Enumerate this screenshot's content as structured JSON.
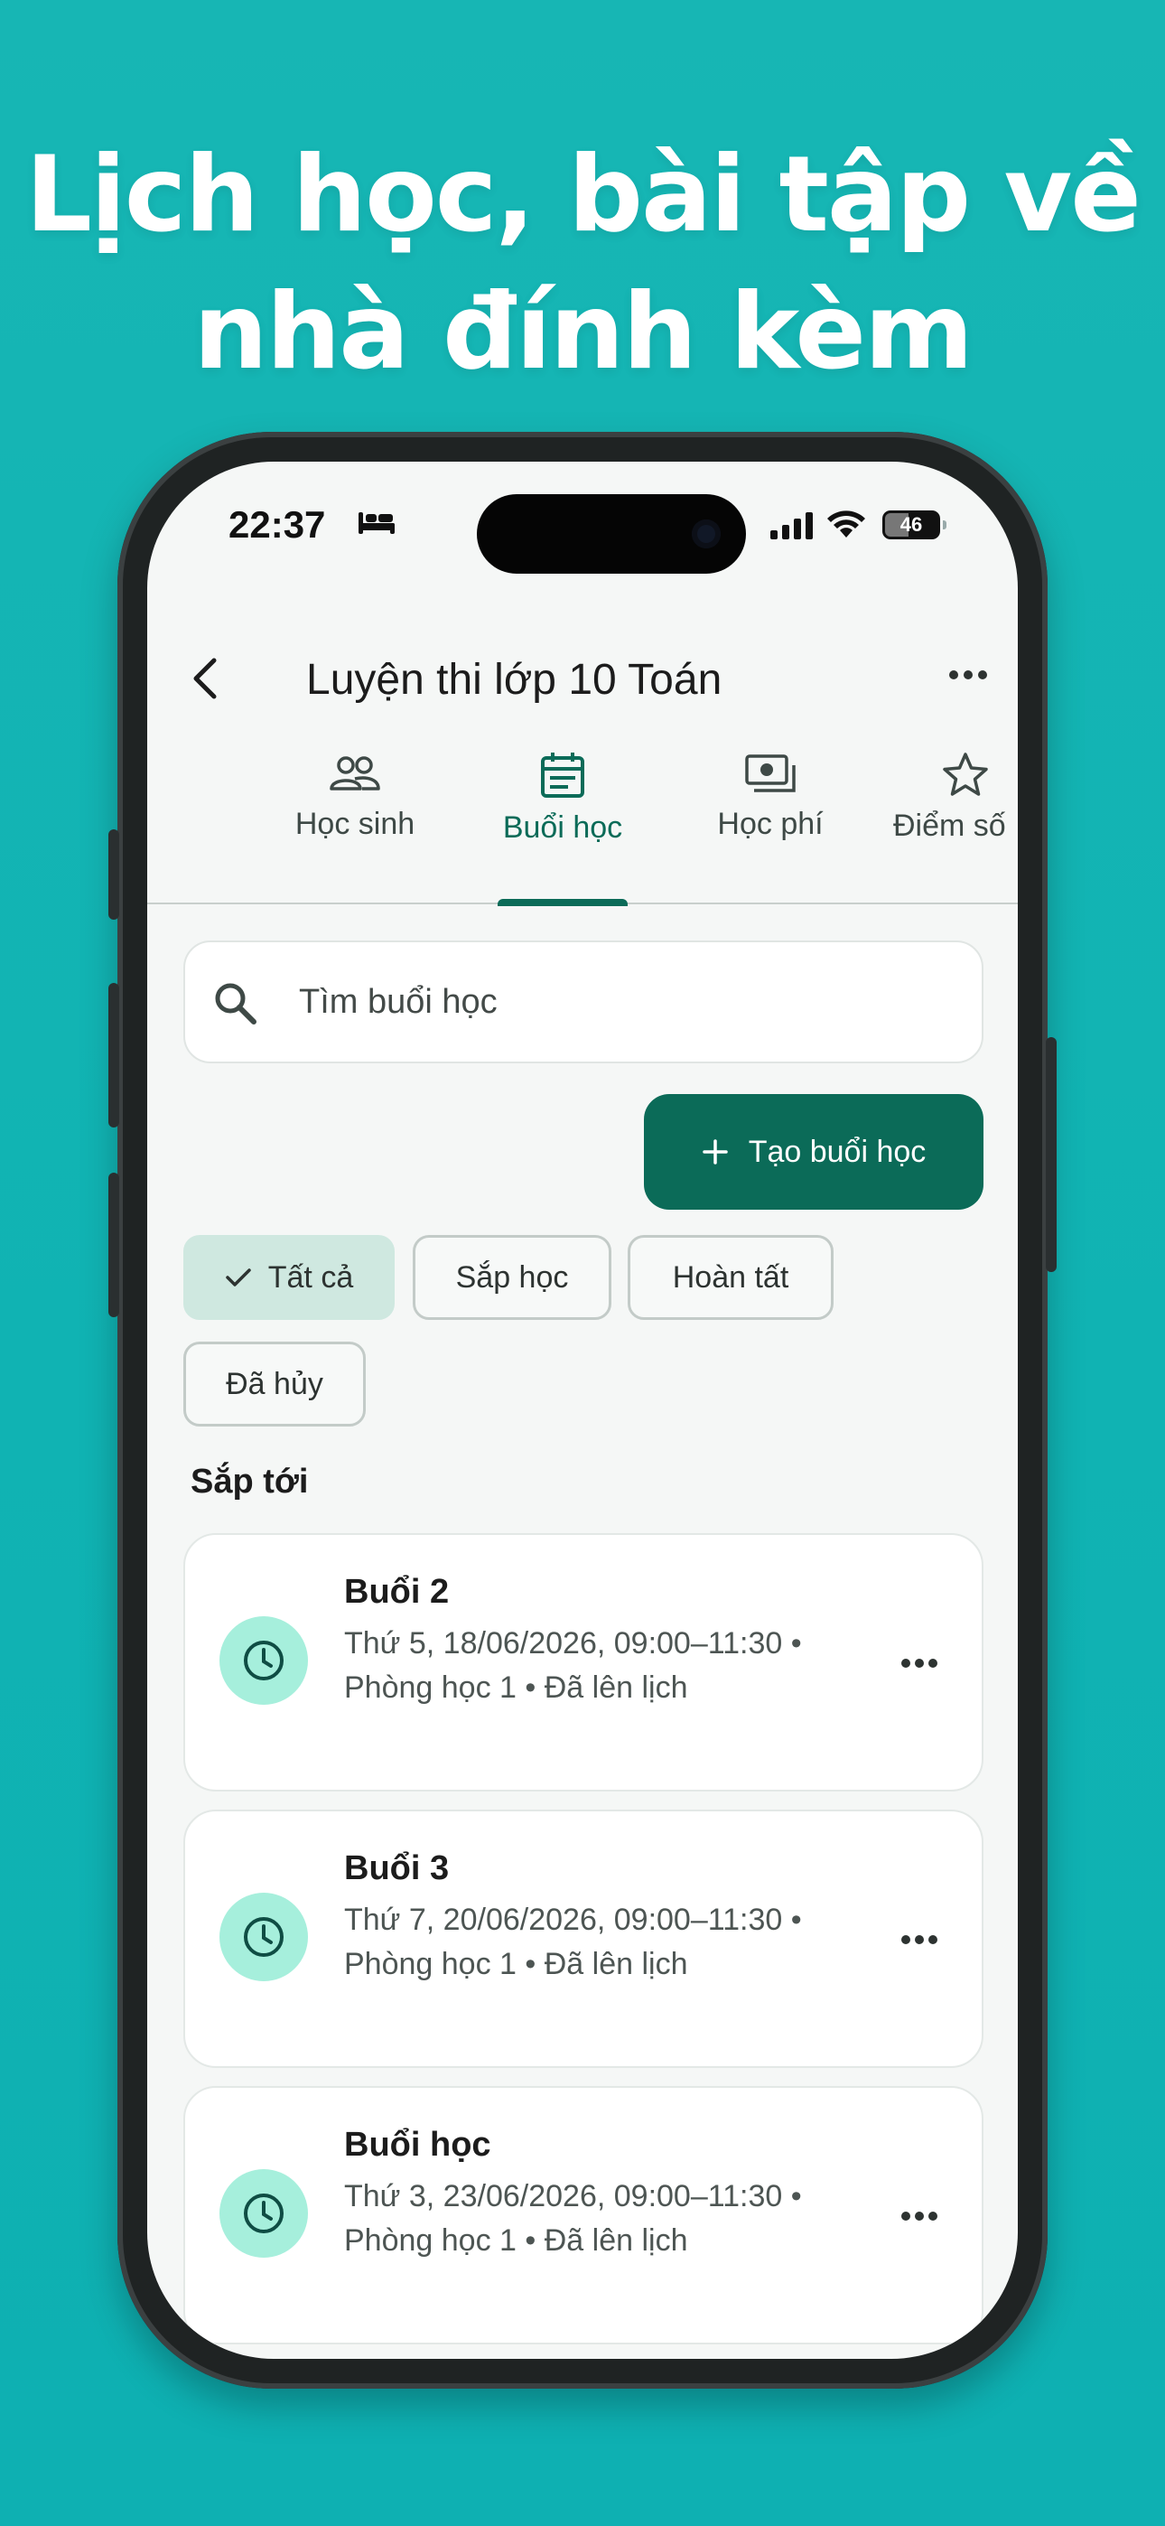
{
  "headline": {
    "line1": "Lịch học, bài tập về",
    "line2": "nhà đính kèm"
  },
  "status_bar": {
    "time": "22:37",
    "battery": "46"
  },
  "app_bar": {
    "title": "Luyện thi lớp 10 Toán"
  },
  "tabs": [
    {
      "label": "Học sinh",
      "icon": "people-icon"
    },
    {
      "label": "Buổi học",
      "icon": "calendar-icon",
      "active": true
    },
    {
      "label": "Học phí",
      "icon": "payments-icon"
    },
    {
      "label": "Điểm số",
      "icon": "star-icon"
    }
  ],
  "search": {
    "placeholder": "Tìm buổi học"
  },
  "create_button": {
    "label": "Tạo buổi học"
  },
  "filters": [
    {
      "label": "Tất cả",
      "selected": true
    },
    {
      "label": "Sắp học"
    },
    {
      "label": "Hoàn tất"
    },
    {
      "label": "Đã hủy"
    }
  ],
  "section": {
    "title": "Sắp tới"
  },
  "sessions": [
    {
      "title": "Buổi 2",
      "detail": "Thứ 5, 18/06/2026, 09:00–11:30 • Phòng học 1 • Đã lên lịch"
    },
    {
      "title": "Buổi 3",
      "detail": "Thứ 7, 20/06/2026, 09:00–11:30 • Phòng học 1 • Đã lên lịch"
    },
    {
      "title": "Buổi học",
      "detail": "Thứ 3, 23/06/2026, 09:00–11:30 • Phòng học 1 • Đã lên lịch"
    }
  ],
  "colors": {
    "background": "#13b4b3",
    "primary": "#0b6b58",
    "chip_selected": "#cfe8e0",
    "icon_circle": "#a6efdc"
  }
}
